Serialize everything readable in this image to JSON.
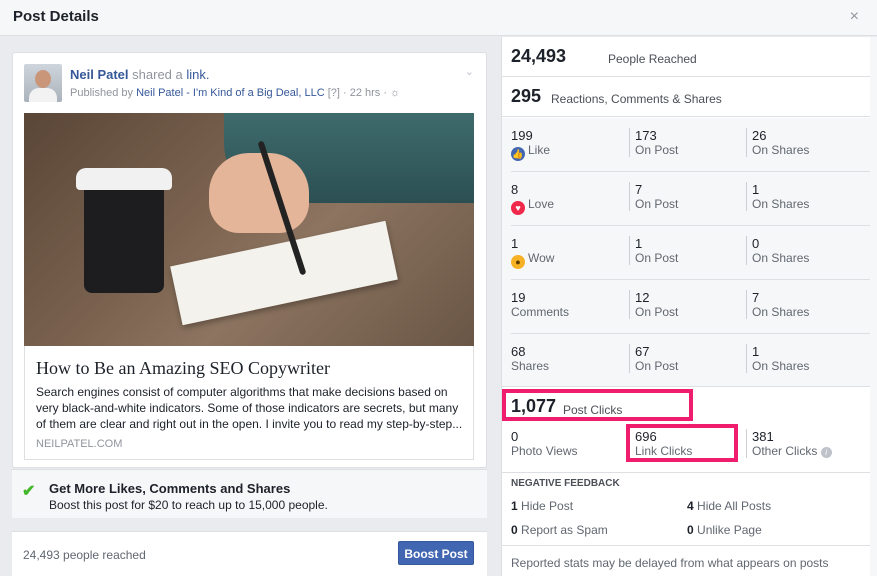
{
  "dialog": {
    "title": "Post Details",
    "close_glyph": "×"
  },
  "post": {
    "author": "Neil Patel",
    "shared_text": "shared a",
    "link_text": "link.",
    "published_by_prefix": "Published by",
    "page_name": "Neil Patel - I'm Kind of a Big Deal, LLC",
    "meta_suffix": "[?] · 22 hrs · ☼",
    "chevron": "⌄",
    "article": {
      "title": "How to Be an Amazing SEO Copywriter",
      "description": "Search engines consist of computer algorithms that make decisions based on very black-and-white indicators. Some of those indicators are secrets, but many of them are clear and right out in the open. I invite you to read my step-by-step...",
      "domain": "NEILPATEL.COM"
    }
  },
  "promo": {
    "title": "Get More Likes, Comments and Shares",
    "text": "Boost this post for $20 to reach up to 15,000 people."
  },
  "bottom": {
    "reached": "24,493 people reached",
    "boost_label": "Boost Post"
  },
  "stats": {
    "reached_num": "24,493",
    "reached_label": "People Reached",
    "reactions_num": "295",
    "reactions_label": "Reactions, Comments & Shares",
    "rows": [
      {
        "v1": "199",
        "l1": "Like",
        "v2": "173",
        "l2": "On Post",
        "v3": "26",
        "l3": "On Shares"
      },
      {
        "v1": "8",
        "l1": "Love",
        "v2": "7",
        "l2": "On Post",
        "v3": "1",
        "l3": "On Shares"
      },
      {
        "v1": "1",
        "l1": "Wow",
        "v2": "1",
        "l2": "On Post",
        "v3": "0",
        "l3": "On Shares"
      },
      {
        "v1": "19",
        "l1": "Comments",
        "v2": "12",
        "l2": "On Post",
        "v3": "7",
        "l3": "On Shares"
      },
      {
        "v1": "68",
        "l1": "Shares",
        "v2": "67",
        "l2": "On Post",
        "v3": "1",
        "l3": "On Shares"
      }
    ],
    "post_clicks_num": "1,077",
    "post_clicks_label": "Post Clicks",
    "photo_views_num": "0",
    "photo_views_label": "Photo Views",
    "link_clicks_num": "696",
    "link_clicks_label": "Link Clicks",
    "other_clicks_num": "381",
    "other_clicks_label": "Other Clicks",
    "info_glyph": "i"
  },
  "negative": {
    "title": "NEGATIVE FEEDBACK",
    "hide_post_num": "1",
    "hide_post_label": "Hide Post",
    "hide_all_num": "4",
    "hide_all_label": "Hide All Posts",
    "spam_num": "0",
    "spam_label": "Report as Spam",
    "unlike_num": "0",
    "unlike_label": "Unlike Page"
  },
  "footnote": "Reported stats may be delayed from what appears on posts",
  "colors": {
    "accent": "#4267b2",
    "link": "#365899",
    "highlight": "#f01d6e",
    "promo_check": "#42b72a"
  }
}
